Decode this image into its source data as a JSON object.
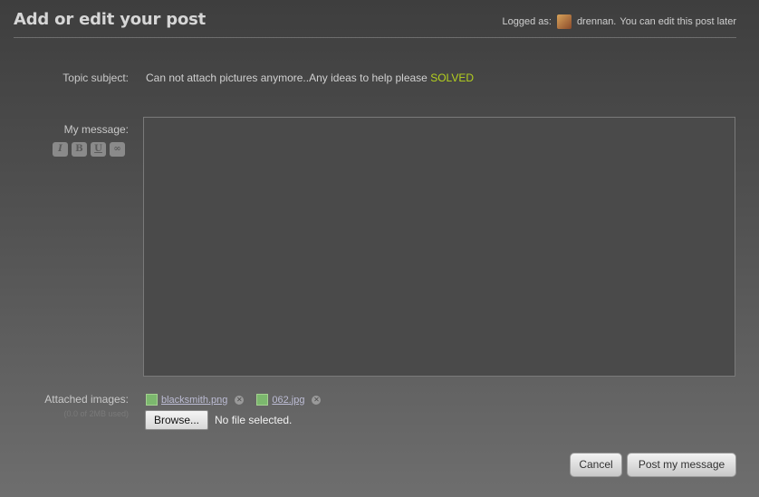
{
  "header": {
    "title": "Add or edit your post",
    "logged_prefix": "Logged as:",
    "username": "drennan.",
    "edit_note": "You can edit this post later"
  },
  "topic": {
    "label": "Topic subject:",
    "value": "Can not attach pictures anymore..Any ideas to help please",
    "tag": "SOLVED"
  },
  "message": {
    "label": "My message:",
    "format_buttons": [
      "I",
      "B",
      "U",
      "∞"
    ]
  },
  "attachments": {
    "label": "Attached images:",
    "usage": "(0.0 of 2MB used)",
    "files": [
      "blacksmith.png",
      "062.jpg"
    ],
    "browse_label": "Browse...",
    "no_file": "No file selected."
  },
  "actions": {
    "cancel": "Cancel",
    "post": "Post my message"
  }
}
